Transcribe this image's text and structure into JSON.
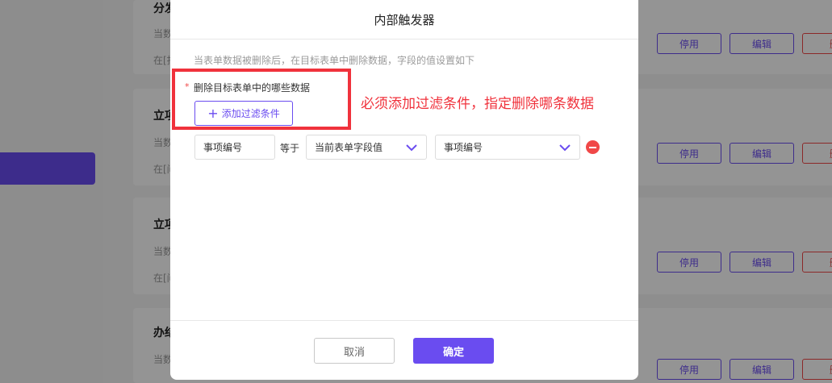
{
  "background": {
    "cards": [
      {
        "title": "分发",
        "line1": "当数",
        "line2": "在[指",
        "btn_disable": "停用",
        "btn_edit": "编辑",
        "btn_delete": "删"
      },
      {
        "title": "立项",
        "line1": "当数",
        "line2": "在[问",
        "btn_disable": "停用",
        "btn_edit": "编辑",
        "btn_delete": "删"
      },
      {
        "title": "立项",
        "line1": "当数",
        "line2": "在[问",
        "btn_disable": "停用",
        "btn_edit": "编辑",
        "btn_delete": "删"
      },
      {
        "title": "办结",
        "line1": "当数",
        "line2": "",
        "btn_disable": "停用",
        "btn_edit": "编辑",
        "btn_delete": "删"
      }
    ]
  },
  "modal": {
    "title": "内部触发器",
    "description": "当表单数据被删除后，在目标表单中删除数据，字段的值设置如下",
    "field_label": "删除目标表单中的哪些数据",
    "required_mark": "*",
    "add_filter_label": "添加过滤条件",
    "annotation": "必须添加过滤条件，指定删除哪条数据",
    "condition": {
      "field": "事项编号",
      "operator": "等于",
      "value_type": "当前表单字段值",
      "value_field": "事项编号"
    },
    "cancel_label": "取消",
    "confirm_label": "确定"
  },
  "colors": {
    "accent": "#6a4cf0",
    "danger": "#f04848",
    "annotation": "#f0323c"
  }
}
